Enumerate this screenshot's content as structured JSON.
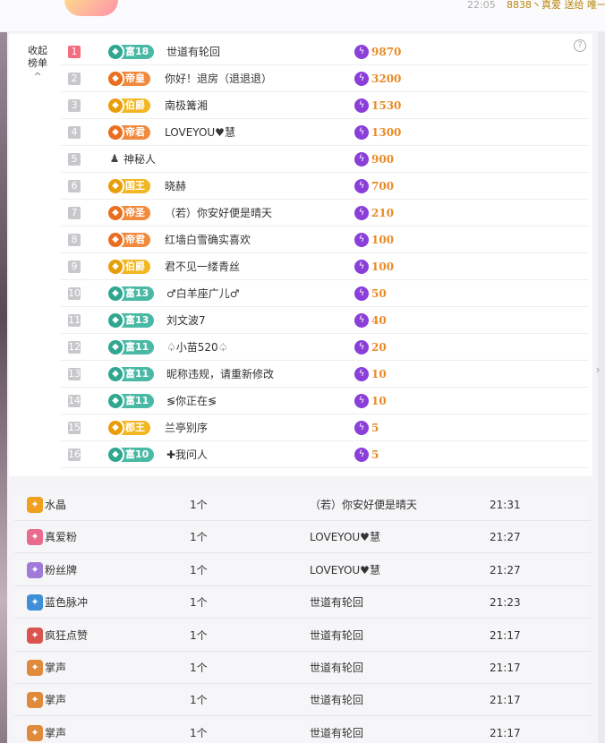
{
  "top_bar": {
    "time": "22:05",
    "message": "8838丶真爱 送给 唯一"
  },
  "rank_panel": {
    "collapse_label": "收起榜单",
    "collapse_chevron": "^",
    "help_icon": "question-circle-icon",
    "score_icon": "lightning-icon",
    "rows": [
      {
        "rank": "1",
        "badge": "富18",
        "badge_color": "#49b9a5",
        "name": "世道有轮回",
        "score": "9870"
      },
      {
        "rank": "2",
        "badge": "帝皇",
        "badge_color": "#f08a3c",
        "name": "你好！退房（退退退）",
        "score": "3200"
      },
      {
        "rank": "3",
        "badge": "伯爵",
        "badge_color": "#f2b621",
        "name": "南极篝湘",
        "score": "1530"
      },
      {
        "rank": "4",
        "badge": "帝君",
        "badge_color": "#f08a3c",
        "name": "LOVEYOU♥慧",
        "score": "1300"
      },
      {
        "rank": "5",
        "badge": "",
        "badge_color": "",
        "name": "神秘人",
        "score": "900"
      },
      {
        "rank": "6",
        "badge": "国王",
        "badge_color": "#f2b621",
        "name": "晓赫",
        "score": "700"
      },
      {
        "rank": "7",
        "badge": "帝圣",
        "badge_color": "#f08a3c",
        "name": "（若）你安好便是晴天",
        "score": "210"
      },
      {
        "rank": "8",
        "badge": "帝君",
        "badge_color": "#f08a3c",
        "name": "红墙白雪确实喜欢",
        "score": "100"
      },
      {
        "rank": "9",
        "badge": "伯爵",
        "badge_color": "#f2b621",
        "name": "君不见一缕青丝",
        "score": "100"
      },
      {
        "rank": "10",
        "badge": "富13",
        "badge_color": "#49b9a5",
        "name": "♂白羊座广儿♂",
        "score": "50"
      },
      {
        "rank": "11",
        "badge": "富13",
        "badge_color": "#49b9a5",
        "name": "刘文波7",
        "score": "40"
      },
      {
        "rank": "12",
        "badge": "富11",
        "badge_color": "#49b9a5",
        "name": "♤小苗520♤",
        "score": "20"
      },
      {
        "rank": "13",
        "badge": "富11",
        "badge_color": "#49b9a5",
        "name": "昵称违规，请重新修改",
        "score": "10"
      },
      {
        "rank": "14",
        "badge": "富11",
        "badge_color": "#49b9a5",
        "name": "≶你正在≶",
        "score": "10"
      },
      {
        "rank": "15",
        "badge": "郡王",
        "badge_color": "#f2b621",
        "name": "兰亭别序",
        "score": "5"
      },
      {
        "rank": "16",
        "badge": "富10",
        "badge_color": "#49b9a5",
        "name": "✚我问人",
        "score": "5"
      }
    ]
  },
  "gift_log": {
    "rows": [
      {
        "icon": "crystal-icon",
        "icon_color": "#f0a020",
        "gift": "水晶",
        "count": "1个",
        "sender": "（若）你安好便是晴天",
        "time": "21:31"
      },
      {
        "icon": "love-fan-icon",
        "icon_color": "#e96b8d",
        "gift": "真爱粉",
        "count": "1个",
        "sender": "LOVEYOU♥慧",
        "time": "21:27"
      },
      {
        "icon": "fan-badge-icon",
        "icon_color": "#a07ad8",
        "gift": "粉丝牌",
        "count": "1个",
        "sender": "LOVEYOU♥慧",
        "time": "21:27"
      },
      {
        "icon": "blue-pulse-icon",
        "icon_color": "#3f8fd8",
        "gift": "蓝色脉冲",
        "count": "1个",
        "sender": "世道有轮回",
        "time": "21:23"
      },
      {
        "icon": "octopus-icon",
        "icon_color": "#d9534f",
        "gift": "疯狂点赞",
        "count": "1个",
        "sender": "世道有轮回",
        "time": "21:17"
      },
      {
        "icon": "clap-icon",
        "icon_color": "#e08a3c",
        "gift": "掌声",
        "count": "1个",
        "sender": "世道有轮回",
        "time": "21:17"
      },
      {
        "icon": "clap-icon",
        "icon_color": "#e08a3c",
        "gift": "掌声",
        "count": "1个",
        "sender": "世道有轮回",
        "time": "21:17"
      },
      {
        "icon": "clap-icon",
        "icon_color": "#e08a3c",
        "gift": "掌声",
        "count": "1个",
        "sender": "世道有轮回",
        "time": "21:17"
      }
    ]
  }
}
